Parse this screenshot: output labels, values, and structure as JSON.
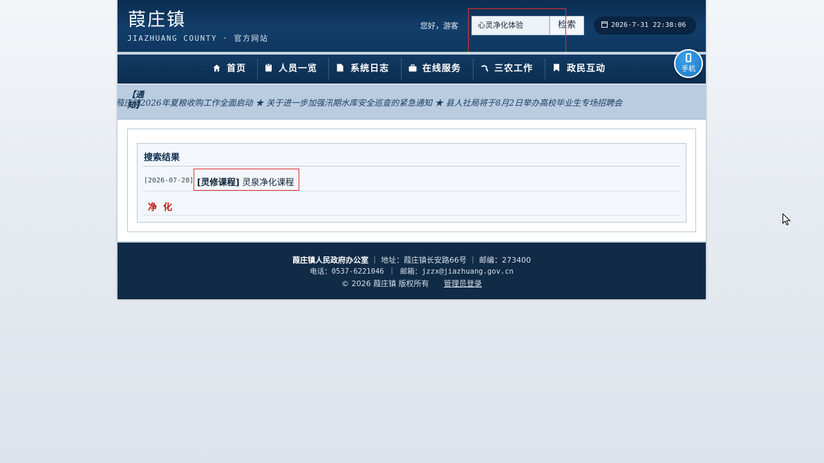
{
  "header": {
    "site_title": "葭庄镇",
    "site_subtitle": "JIAZHUANG COUNTY · 官方网站",
    "greeting": "您好，游客",
    "search_value": "心灵净化体验",
    "search_button": "检索",
    "datetime": "2026-7-31 22:38:06"
  },
  "nav": {
    "items": [
      {
        "label": "首页",
        "icon": "home-icon"
      },
      {
        "label": "人员一览",
        "icon": "clipboard-icon"
      },
      {
        "label": "系统日志",
        "icon": "document-icon"
      },
      {
        "label": "在线服务",
        "icon": "briefcase-icon"
      },
      {
        "label": "三农工作",
        "icon": "sickle-icon"
      },
      {
        "label": "政民互动",
        "icon": "bookmark-icon"
      }
    ],
    "mobile_label": "手机"
  },
  "ticker": {
    "label": "【通知】",
    "text": "葭庄镇2026年夏粮收购工作全面启动 ★ 关于进一步加强汛期水库安全巡查的紧急通知 ★ 县人社局将于8月2日举办高校毕业生专场招聘会"
  },
  "results": {
    "title": "搜索结果",
    "items": [
      {
        "date": "[2026-07-28]",
        "category": "[灵修课程]",
        "title": "灵泉净化课程"
      }
    ],
    "tag": "净化"
  },
  "footer": {
    "office": "葭庄镇人民政府办公室",
    "address": "｜ 地址：葭庄镇长安路66号 ｜ 邮编：273400",
    "contact": "电话：0537-6221046 ｜ 邮箱：jzzx@jiazhuang.gov.cn",
    "copyright": "© 2026 葭庄镇 版权所有",
    "admin_link": "管理员登录"
  },
  "colors": {
    "header_bg": "#0f3760",
    "nav_bg": "#0c2d50",
    "ticker_bg": "#b9cce0",
    "footer_bg": "#112b47",
    "highlight": "#e03030",
    "tag_red": "#c01818"
  }
}
